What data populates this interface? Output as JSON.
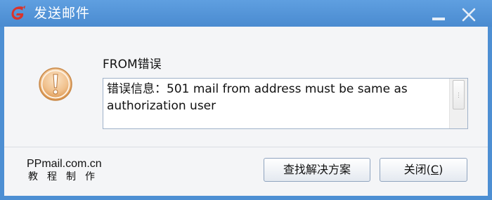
{
  "window": {
    "title": "发送邮件",
    "logo_icon": "ppmail-logo-icon",
    "minimize_icon": "minimize-icon",
    "close_icon": "close-icon",
    "title_bar_color": "#4d8fd3"
  },
  "dialog": {
    "icon": "warning-exclamation-icon",
    "icon_color": "#e8a860",
    "heading": "FROM错误",
    "message": "错误信息：501 mail from address must be same as authorization user"
  },
  "watermark": {
    "line1": "PPmail.com.cn",
    "line2": "教程制作"
  },
  "buttons": {
    "find_solution": "查找解决方案",
    "close_label": "关闭(",
    "close_shortcut": "C",
    "close_suffix": ")"
  }
}
